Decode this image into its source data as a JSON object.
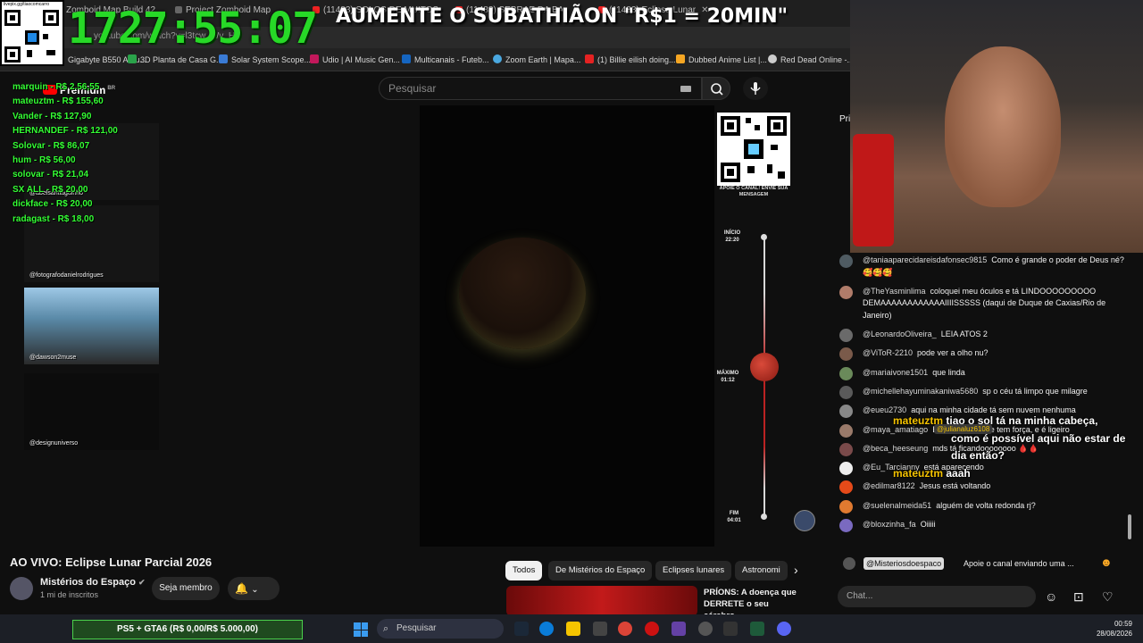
{
  "browser": {
    "tabs": [
      {
        "label": "Zomboid Map Build 42"
      },
      {
        "label": "Project Zomboid Map"
      },
      {
        "label": "(11483) SOLOS DE MUITOS"
      },
      {
        "label": "(11483) SEBRAE DA BAI"
      },
      {
        "label": "(11483) Eclipse Lunar"
      }
    ],
    "url": "youtube.com/watch?v=l3tcw_Wv_H",
    "bookmarks": [
      {
        "label": "Gigabyte B550 Aoru...",
        "color": "#e06010"
      },
      {
        "label": "3D Planta de Casa G...",
        "color": "#2aa34a"
      },
      {
        "label": "Solar System Scope...",
        "color": "#3a7bd5"
      },
      {
        "label": "Udio | AI Music Gen...",
        "color": "#c2185b"
      },
      {
        "label": "Multicanais - Futeb...",
        "color": "#1565c0"
      },
      {
        "label": "Zoom Earth | Mapa...",
        "color": "#4aa8e0"
      },
      {
        "label": "(1) Billie eilish doing...",
        "color": "#e52222"
      },
      {
        "label": "Dubbed Anime List |...",
        "color": "#f5a623"
      },
      {
        "label": "Red Dead Online -...",
        "color": "#cccccc"
      }
    ]
  },
  "overlay": {
    "qr_label": "livepix.gg/tiaocomcarro",
    "timer": "1727:55:07",
    "banner": "AUMENTE O SUBATHIÃON \"R$1 = 20MIN\"",
    "donations": [
      "marquin - R$ 2.56,55",
      "mateuztm - R$ 155,60",
      "Vander - R$ 127,90",
      "HERNANDEF - R$ 121,00",
      "Solovar - R$ 86,07",
      "hum - R$ 56,00",
      "solovar - R$ 21,04",
      "SX ALL - R$ 20,00",
      "dickface - R$ 20,00",
      "radagast - R$ 18,00"
    ],
    "cams": [
      {
        "label": "@abelsantiaguinho"
      },
      {
        "label": "@fotografodanielrodrigues"
      },
      {
        "label": "@dawson2muse"
      },
      {
        "label": "@designuniverso"
      }
    ],
    "goal": "PS5 + GTA6 (R$ 0,00/R$ 5.000,00)",
    "overlay_chat": [
      {
        "name": "mateuztm",
        "text": "tiao o sol tá na minha cabeça,"
      },
      {
        "name": "",
        "text": "como é possível aqui não estar de"
      },
      {
        "name": "",
        "text": "dia então?"
      },
      {
        "name": "mateuztm",
        "text": "aaah"
      }
    ],
    "reply_tag": "@julianaluz6108"
  },
  "youtube": {
    "logo": "Premium",
    "region": "BR",
    "search_placeholder": "Pesquisar",
    "video": {
      "qr_caption": "APOIE O CANAL! ENVIE SUA MENSAGEM",
      "timeline": {
        "start_label": "INÍCIO",
        "start_time": "22:20",
        "max_label": "MÁXIMO",
        "max_time": "01:12",
        "end_label": "FIM",
        "end_time": "04:01"
      }
    },
    "title": "AO VIVO: Eclipse Lunar Parcial 2026",
    "channel": {
      "name": "Mistérios do Espaço",
      "subs": "1 mi de inscritos"
    },
    "member_button": "Seja membro",
    "chips": [
      "Todos",
      "De Mistérios do Espaço",
      "Eclipses lunares",
      "Astronomi"
    ],
    "recommendation": {
      "title": "PRÍONS: A doença que DERRETE o seu cérebro"
    }
  },
  "chat": {
    "header": "Pri",
    "messages": [
      {
        "author": "@taniaaparecidareisdafonsec9815",
        "text": "Como é grande o poder de Deus né? 🥰🥰🥰",
        "color": "#4f5b62"
      },
      {
        "author": "@TheYasminlima",
        "text": "coloquei meu óculos e tá LINDOOOOOOOOO DEMAAAAAAAAAAAAIIIISSSSS (daqui de Duque de Caxias/Rio de Janeiro)",
        "color": "#b07c6a"
      },
      {
        "author": "@LeonardoOliveira_",
        "text": "LEIA ATOS 2",
        "color": "#6a6a6a"
      },
      {
        "author": "@ViToR-2210",
        "text": "pode ver a olho nu?",
        "color": "#7a5a4a"
      },
      {
        "author": "@mariaivone1501",
        "text": "que linda",
        "color": "#6a8a5a"
      },
      {
        "author": "@michellehayuminakaniwa5680",
        "text": "sp o céu tá limpo que milagre",
        "color": "#5a5a5a"
      },
      {
        "author": "@eueu2730",
        "text": "aqui na minha cidade tá sem nuvem nenhuma",
        "color": "#888888"
      },
      {
        "author": "@maya_amatiago",
        "text": "Eitchaaa, que ele tem força, e é ligeiro",
        "color": "#9a7a6a"
      },
      {
        "author": "@beca_heeseung",
        "text": "mds tá ficandoooooooo 🩸🩸",
        "color": "#7a4a4a"
      },
      {
        "author": "@Eu_Tarcianny",
        "text": "está aparecendo",
        "color": "#eeeeee"
      },
      {
        "author": "@edilmar8122",
        "text": "Jesus está voltando",
        "color": "#e64a19"
      },
      {
        "author": "@suelenalmeida51",
        "text": "alguém de volta redonda rj?",
        "color": "#e07a30"
      },
      {
        "author": "@bloxzinha_fa",
        "text": "Oiiiii",
        "color": "#7a6ac0"
      }
    ],
    "pinned": {
      "author": "@Misteriosdoespaco",
      "text": "Apoie o canal enviando uma ..."
    },
    "input_placeholder": "Chat..."
  },
  "taskbar": {
    "search": "Pesquisar",
    "time": "00:59",
    "date": "28/08/2026"
  }
}
